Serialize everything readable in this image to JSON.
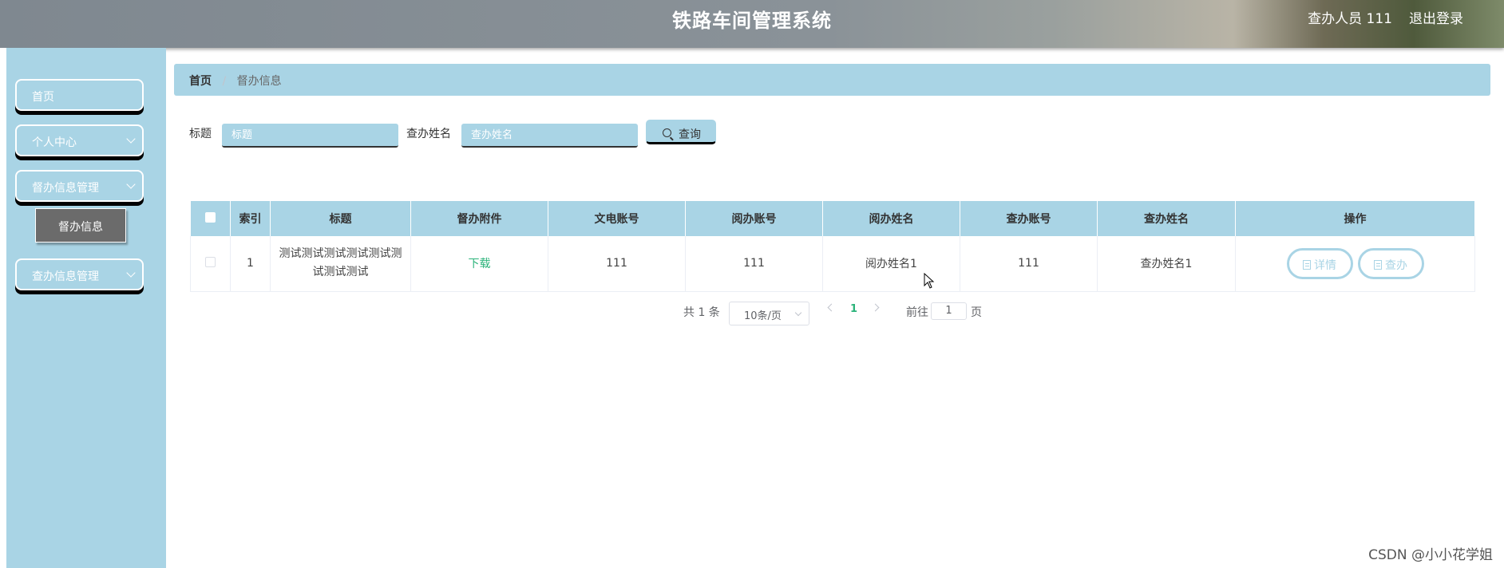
{
  "header": {
    "title": "铁路车间管理系统",
    "user": "查办人员 111",
    "logout": "退出登录"
  },
  "sidebar": {
    "items": [
      {
        "label": "首页"
      },
      {
        "label": "个人中心"
      },
      {
        "label": "督办信息管理"
      },
      {
        "label": "查办信息管理"
      }
    ],
    "submenu_active": "督办信息"
  },
  "breadcrumb": {
    "home": "首页",
    "separator": "/",
    "current": "督办信息"
  },
  "search": {
    "title_label": "标题",
    "title_placeholder": "标题",
    "name_label": "查办姓名",
    "name_placeholder": "查办姓名",
    "query_button": "查询"
  },
  "table": {
    "headers": [
      "索引",
      "标题",
      "督办附件",
      "文电账号",
      "阅办账号",
      "阅办姓名",
      "查办账号",
      "查办姓名",
      "操作"
    ],
    "rows": [
      {
        "index": "1",
        "title": "测试测试测试测试测试测试测试测试",
        "attachment": "下载",
        "doc_account": "111",
        "read_account": "111",
        "read_name": "阅办姓名1",
        "check_account": "111",
        "check_name": "查办姓名1",
        "detail_btn": "详情",
        "check_btn": "查办"
      }
    ]
  },
  "pagination": {
    "total": "共 1 条",
    "page_size": "10条/页",
    "current_page": "1",
    "goto_label": "前往",
    "goto_value": "1",
    "page_suffix": "页"
  },
  "watermark": "CSDN @小小花学姐",
  "colors": {
    "accent": "#a9d4e5",
    "link_green": "#2bb37a"
  }
}
